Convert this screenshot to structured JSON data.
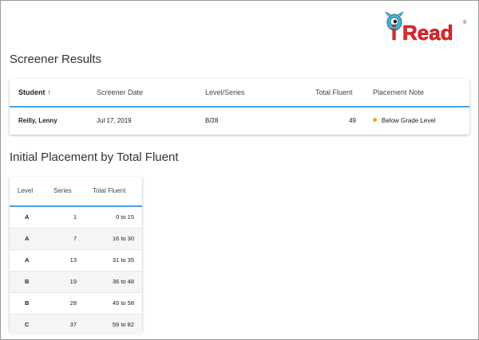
{
  "brand": {
    "name": "Read",
    "prefix": "i",
    "mark": "®"
  },
  "results": {
    "title": "Screener Results",
    "columns": {
      "student": "Student",
      "date": "Screener Date",
      "level": "Level/Series",
      "fluent": "Total Fluent",
      "note": "Placement Note"
    },
    "sort_icon": "arrow-up-icon",
    "row": {
      "student": "Reilly, Lenny",
      "date": "Jul 17, 2019",
      "level": "B/28",
      "fluent": "49",
      "note": "Below Grade Level",
      "note_color": "#f2a900"
    }
  },
  "placement": {
    "title": "Initial Placement by Total Fluent",
    "columns": {
      "level": "Level",
      "series": "Series",
      "fluent": "Total Fluent"
    },
    "rows": [
      {
        "level": "A",
        "series": "1",
        "fluent": "0 to 15"
      },
      {
        "level": "A",
        "series": "7",
        "fluent": "16 to 30"
      },
      {
        "level": "A",
        "series": "13",
        "fluent": "31 to 35"
      },
      {
        "level": "B",
        "series": "19",
        "fluent": "36 to 48"
      },
      {
        "level": "B",
        "series": "28",
        "fluent": "49 to 58"
      },
      {
        "level": "C",
        "series": "37",
        "fluent": "59 to 82"
      }
    ]
  },
  "colors": {
    "accent": "#4a9fe0",
    "brand_red": "#e8262a",
    "brand_teal": "#3fb6d8"
  }
}
